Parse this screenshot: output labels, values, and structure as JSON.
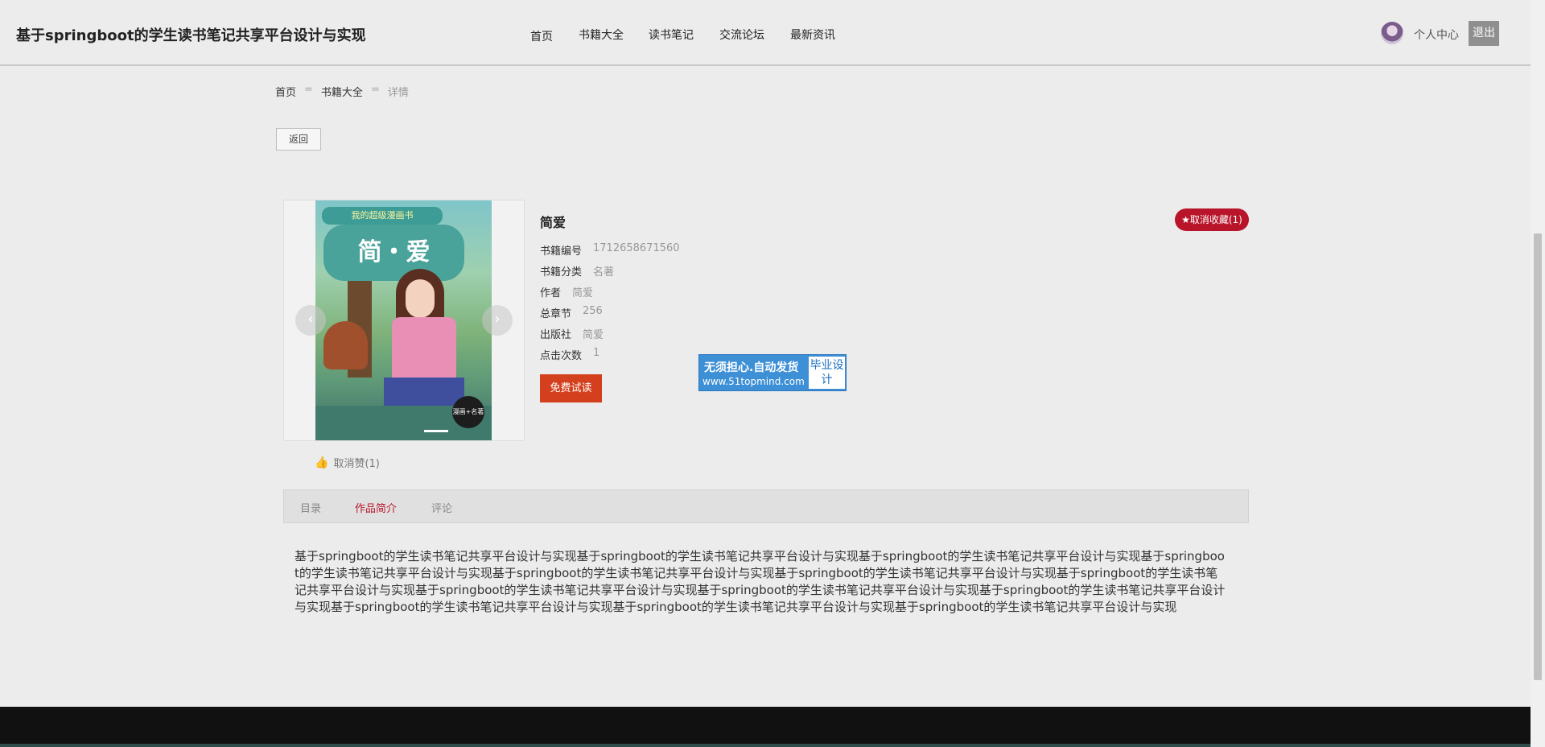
{
  "header": {
    "site_title": "基于springboot的学生读书笔记共享平台设计与实现",
    "nav": [
      "首页",
      "书籍大全",
      "读书笔记",
      "交流论坛",
      "最新资讯"
    ],
    "user_center": "个人中心",
    "logout": "退出"
  },
  "breadcrumb": {
    "home": "首页",
    "separator": "=",
    "category": "书籍大全",
    "current": "详情"
  },
  "back_button": "返回",
  "book": {
    "title": "简爱",
    "favorite_button": "★取消收藏(1)",
    "info": [
      {
        "label": "书籍编号",
        "value": "1712658671560"
      },
      {
        "label": "书籍分类",
        "value": "名著"
      },
      {
        "label": "作者",
        "value": "简爱"
      },
      {
        "label": "总章节",
        "value": "256"
      },
      {
        "label": "出版社",
        "value": "简爱"
      },
      {
        "label": "点击次数",
        "value": "1"
      }
    ],
    "trial_button": "免费试读",
    "like": "取消赞(1)",
    "cover": {
      "banner": "我的超级漫画书",
      "title": "简・爱",
      "seal": "漫画+名著"
    }
  },
  "ad": {
    "line1": "无须担心.自动发货",
    "line2": "www.51topmind.com",
    "badge": "毕业设计"
  },
  "tabs": [
    "目录",
    "作品简介",
    "评论"
  ],
  "active_tab": "作品简介",
  "content": "基于springboot的学生读书笔记共享平台设计与实现基于springboot的学生读书笔记共享平台设计与实现基于springboot的学生读书笔记共享平台设计与实现基于springboot的学生读书笔记共享平台设计与实现基于springboot的学生读书笔记共享平台设计与实现基于springboot的学生读书笔记共享平台设计与实现基于springboot的学生读书笔记共享平台设计与实现基于springboot的学生读书笔记共享平台设计与实现基于springboot的学生读书笔记共享平台设计与实现基于springboot的学生读书笔记共享平台设计与实现基于springboot的学生读书笔记共享平台设计与实现基于springboot的学生读书笔记共享平台设计与实现基于springboot的学生读书笔记共享平台设计与实现",
  "colors": {
    "accent": "#b8152a",
    "trial": "#d4401e",
    "ad": "#3d8fd6"
  }
}
